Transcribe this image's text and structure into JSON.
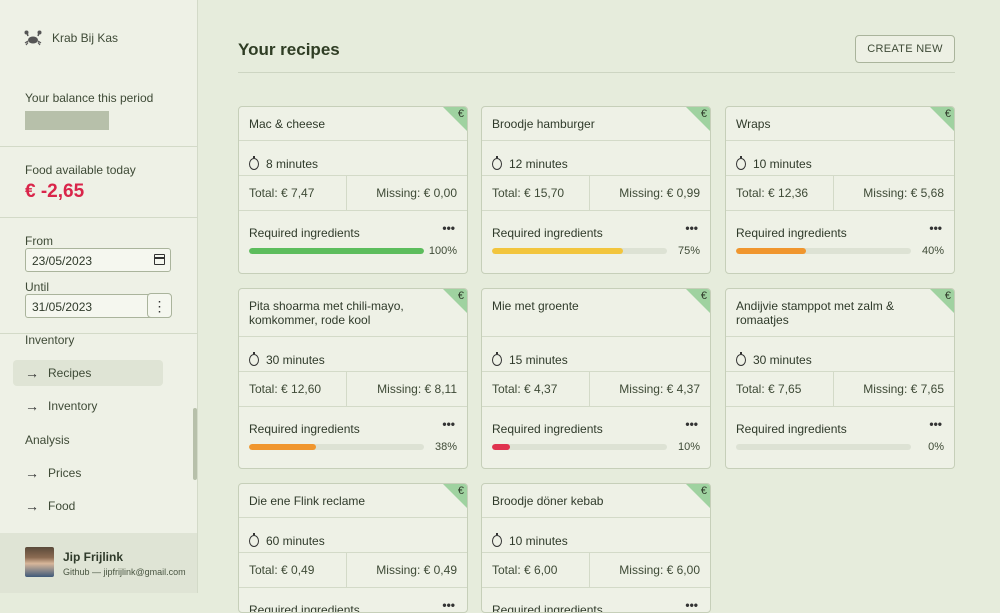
{
  "sidebar": {
    "brand": "Krab Bij Kas",
    "balance_label": "Your balance this period",
    "food_label": "Food available today",
    "food_value": "€ -2,65",
    "from_label": "From",
    "from_value": "23/05/2023",
    "until_label": "Until",
    "until_value": "31/05/2023",
    "more_glyph": "⋮",
    "section_inventory": "Inventory",
    "section_analysis": "Analysis",
    "nav": [
      {
        "label": "Recipes",
        "active": true
      },
      {
        "label": "Inventory",
        "active": false
      },
      {
        "label": "Prices",
        "active": false
      },
      {
        "label": "Food",
        "active": false
      }
    ],
    "user": {
      "name": "Jip Frijlink",
      "sub": "Github — jipfrijlink@gmail.com"
    }
  },
  "main": {
    "title": "Your recipes",
    "create_label": "CREATE NEW"
  },
  "recipes": [
    {
      "title": "Mac & cheese",
      "time": "8 minutes",
      "total": "Total: € 7,47",
      "missing": "Missing: € 0,00",
      "req": "Required ingredients",
      "pct_label": "100%",
      "pct": 100,
      "color": "#5cbd5c"
    },
    {
      "title": "Broodje hamburger",
      "time": "12 minutes",
      "total": "Total: € 15,70",
      "missing": "Missing: € 0,99",
      "req": "Required ingredients",
      "pct_label": "75%",
      "pct": 75,
      "color": "#f2c53d"
    },
    {
      "title": "Wraps",
      "time": "10 minutes",
      "total": "Total: € 12,36",
      "missing": "Missing: € 5,68",
      "req": "Required ingredients",
      "pct_label": "40%",
      "pct": 40,
      "color": "#f0962e"
    },
    {
      "title": "Pita shoarma met chili-mayo, komkommer, rode kool",
      "time": "30 minutes",
      "total": "Total: € 12,60",
      "missing": "Missing: € 8,11",
      "req": "Required ingredients",
      "pct_label": "38%",
      "pct": 38,
      "color": "#f0962e"
    },
    {
      "title": "Mie met groente",
      "time": "15 minutes",
      "total": "Total: € 4,37",
      "missing": "Missing: € 4,37",
      "req": "Required ingredients",
      "pct_label": "10%",
      "pct": 10,
      "color": "#e0334f"
    },
    {
      "title": "Andijvie stamppot met zalm & romaatjes",
      "time": "30 minutes",
      "total": "Total: € 7,65",
      "missing": "Missing: € 7,65",
      "req": "Required ingredients",
      "pct_label": "0%",
      "pct": 0,
      "color": "#e0334f"
    },
    {
      "title": "Die ene Flink reclame",
      "time": "60 minutes",
      "total": "Total: € 0,49",
      "missing": "Missing: € 0,49",
      "req": "Required ingredients",
      "pct_label": "",
      "pct": 0,
      "color": "#e0334f"
    },
    {
      "title": "Broodje döner kebab",
      "time": "10 minutes",
      "total": "Total: € 6,00",
      "missing": "Missing: € 6,00",
      "req": "Required ingredients",
      "pct_label": "",
      "pct": 0,
      "color": "#e0334f"
    }
  ],
  "badge_glyph": "€",
  "dots_glyph": "•••"
}
